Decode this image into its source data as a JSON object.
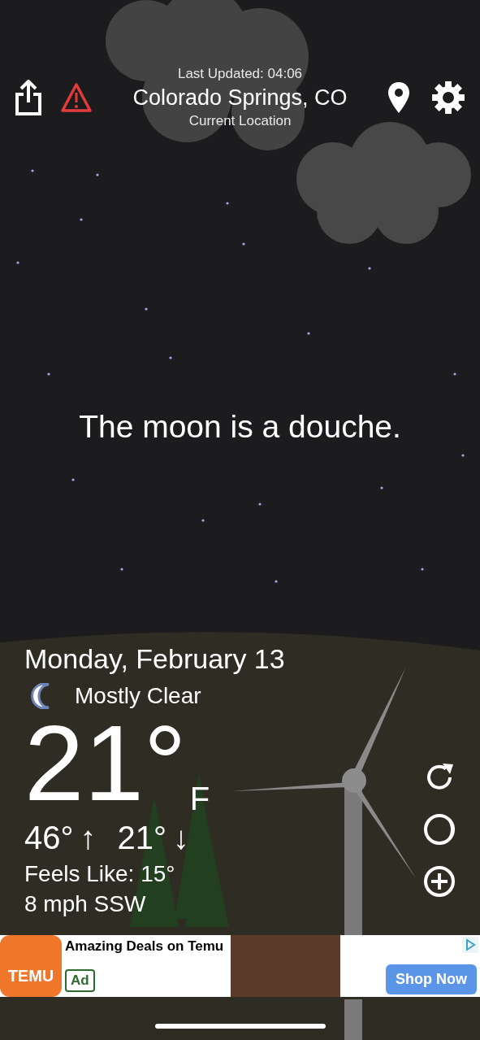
{
  "header": {
    "last_updated": "Last Updated: 04:06",
    "location": "Colorado Springs, CO",
    "location_note": "Current Location"
  },
  "message": "The moon is a douche.",
  "weather": {
    "date": "Monday, February 13",
    "condition": "Mostly Clear",
    "temperature": "21°",
    "unit": "F",
    "high": "46°",
    "high_arrow": "↑",
    "low": "21°",
    "low_arrow": "↓",
    "feels_like": "Feels Like: 15°",
    "wind": "8 mph SSW"
  },
  "ad": {
    "logo_text": "TEMU",
    "headline": "Amazing Deals on Temu",
    "badge": "Ad",
    "button": "Shop Now"
  }
}
